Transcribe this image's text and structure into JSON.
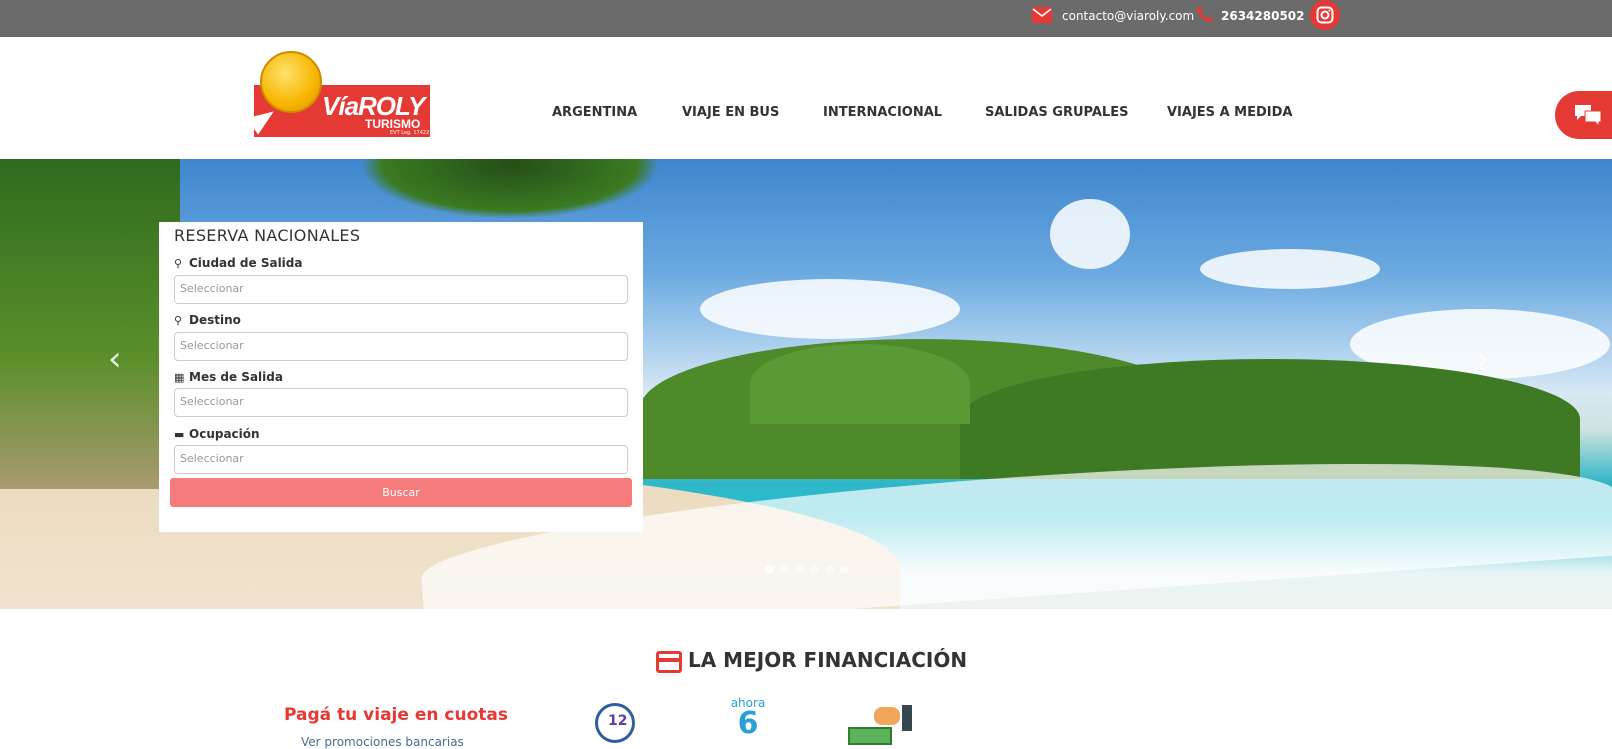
{
  "topbar": {
    "email": "contacto@viaroly.com",
    "phone": "2634280502",
    "icons": [
      "mail-icon",
      "phone-icon",
      "instagram-icon"
    ]
  },
  "logo": {
    "brand": "VíaROLY",
    "sub": "TURISMO",
    "license": "EVT Leg. 17422"
  },
  "nav": {
    "items": [
      "ARGENTINA",
      "VIAJE EN BUS",
      "INTERNACIONAL",
      "SALIDAS GRUPALES",
      "VIAJES A MEDIDA"
    ]
  },
  "hero": {
    "prev_icon": "chevron-left-icon",
    "next_icon": "chevron-right-icon"
  },
  "booking": {
    "title": "RESERVA NACIONALES",
    "fields": [
      {
        "label": "Ciudad de Salida",
        "value": "Seleccionar",
        "icon": "map-marker-icon"
      },
      {
        "label": "Destino",
        "value": "Seleccionar",
        "icon": "map-marker-icon"
      },
      {
        "label": "Mes de Salida",
        "value": "Seleccionar",
        "icon": "calendar-icon"
      },
      {
        "label": "Ocupación",
        "value": "Seleccionar",
        "icon": "bed-icon"
      }
    ],
    "button": "Buscar"
  },
  "financing": {
    "title": "LA MEJOR FINANCIACIÓN",
    "tagline": "Pagá tu viaje en cuotas",
    "link": "Ver promociones bancarias",
    "ahora_label": "ahora",
    "ahora_number": "6",
    "badge_12": "12"
  },
  "colors": {
    "brand_red": "#e53935",
    "topbar_gray": "#6b6b6b",
    "button_pink": "#f47c7c"
  }
}
